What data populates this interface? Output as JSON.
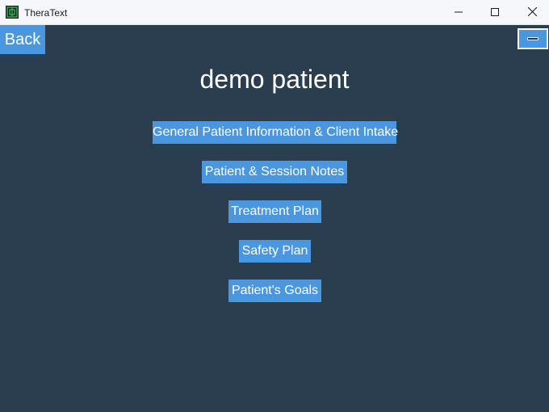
{
  "window": {
    "title": "TheraText",
    "icon": "theratext-app-icon",
    "controls": {
      "minimize_icon": "minimize-icon",
      "maximize_icon": "maximize-icon",
      "close_icon": "close-icon"
    }
  },
  "colors": {
    "background": "#2b3e50",
    "accent": "#4a97e0",
    "text": "#ffffff"
  },
  "toolbar": {
    "back_label": "Back",
    "toggle_icon": "toggle-icon"
  },
  "patient": {
    "name": "demo patient"
  },
  "menu": {
    "items": [
      {
        "label": "General Patient Information & Client Intake"
      },
      {
        "label": "Patient & Session Notes"
      },
      {
        "label": "Treatment Plan"
      },
      {
        "label": "Safety Plan"
      },
      {
        "label": "Patient's Goals"
      }
    ]
  }
}
